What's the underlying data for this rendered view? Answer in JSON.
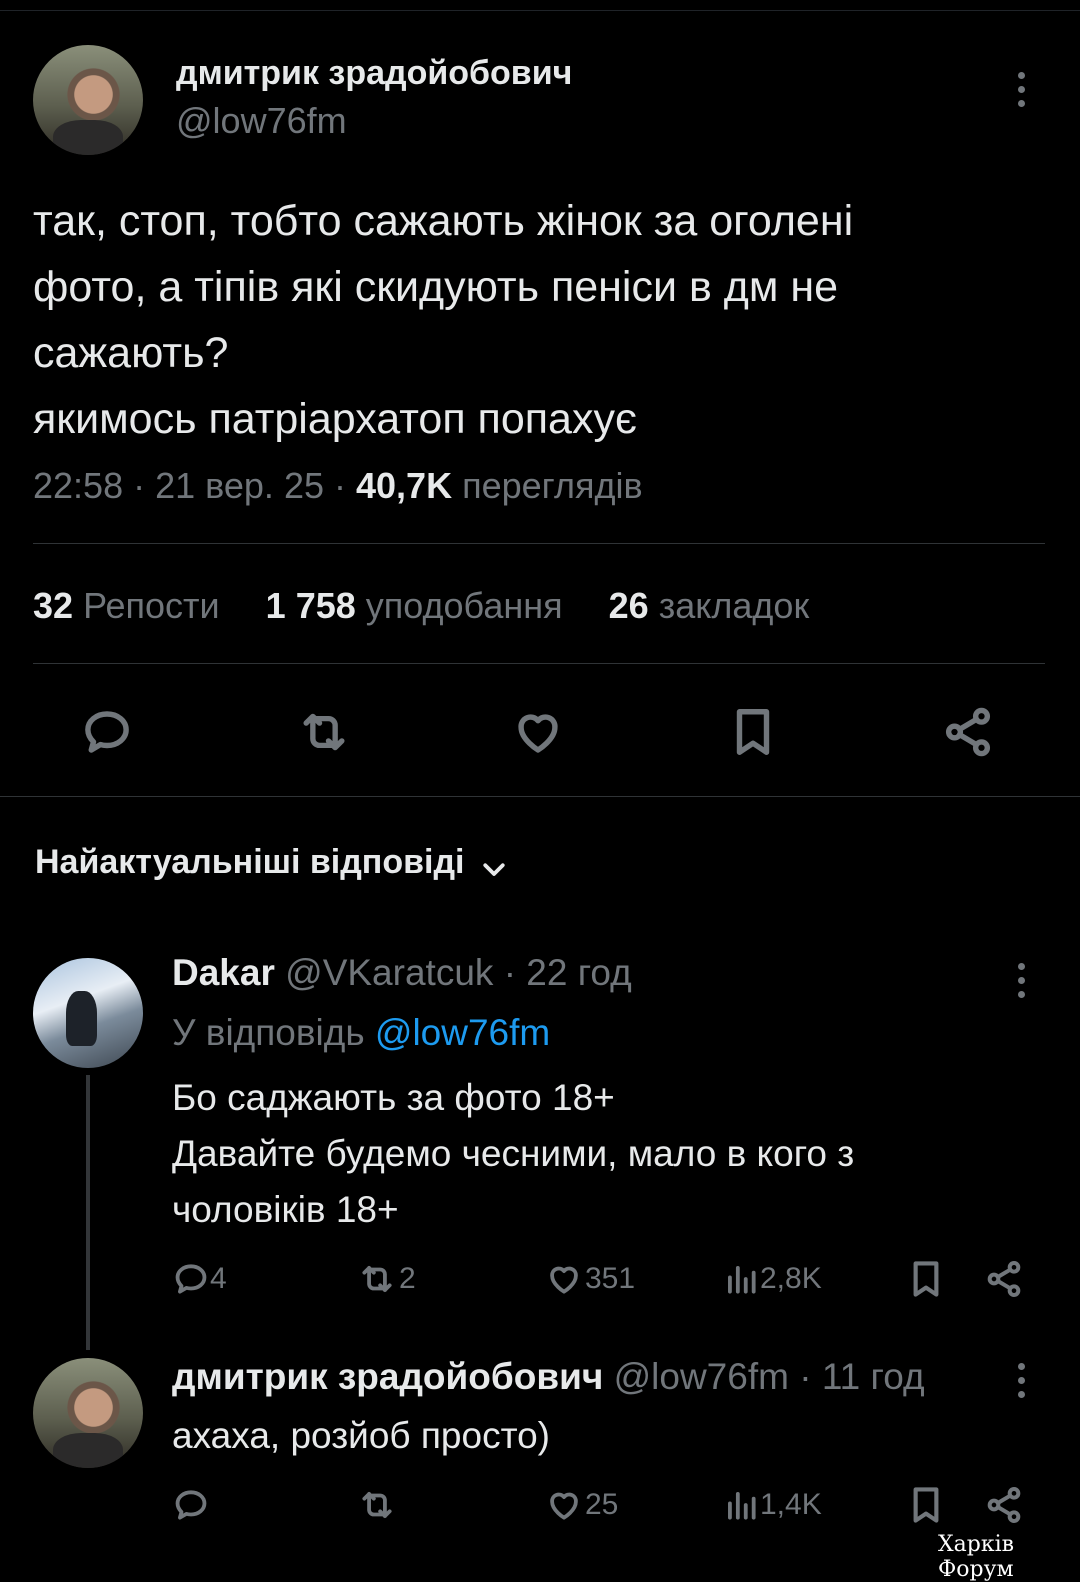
{
  "main_tweet": {
    "author_name": "дмитрик зрадойобович",
    "author_handle": "@low76fm",
    "text_lines": [
      "так, стоп, тобто сажають жінок за оголені",
      "фото, а тіпів які скидують пеніси в дм не",
      "сажають?",
      "якимось патріархатоп попахує"
    ],
    "time": "22:58",
    "date": "21 вер. 25",
    "views_count": "40,7K",
    "views_label": "переглядів",
    "reposts_count": "32",
    "reposts_label": "Репости",
    "likes_count": "1 758",
    "likes_label": "уподобання",
    "bookmarks_count": "26",
    "bookmarks_label": "закладок"
  },
  "replies_header": {
    "label": "Найактуальніші відповіді"
  },
  "replies": [
    {
      "author_name": "Dakar",
      "author_handle": "@VKaratcuk",
      "time_ago": "22 год",
      "reply_to_prefix": "У відповідь",
      "reply_to_handle": "@low76fm",
      "text_lines": [
        "Бо саджають за фото 18+",
        "Давайте будемо чесними, мало в кого з",
        "чоловіків 18+"
      ],
      "comments": "4",
      "reposts": "2",
      "likes": "351",
      "views": "2,8K"
    },
    {
      "author_name": "дмитрик зрадойобович",
      "author_handle": "@low76fm",
      "time_ago": "11 год",
      "text_lines": [
        "ахаха, розйоб просто)"
      ],
      "comments": "",
      "reposts": "",
      "likes": "25",
      "views": "1,4K"
    }
  ],
  "watermark": "Харків Форум",
  "colors": {
    "background": "#000000",
    "text": "#e7e9ea",
    "muted": "#71767b",
    "link": "#1d9bf0",
    "separator": "#2f3336"
  },
  "dot_separator": "·"
}
